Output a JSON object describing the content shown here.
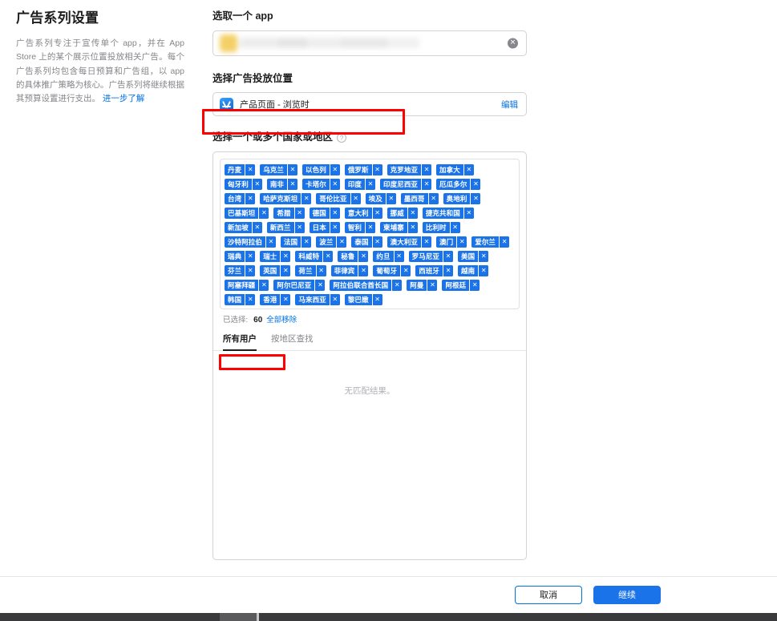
{
  "left": {
    "title": "广告系列设置",
    "description_before_link": "广告系列专注于宣传单个 app，并在 App Store 上的某个展示位置投放相关广告。每个广告系列均包含每日预算和广告组，以 app 的具体推广策略为核心。广告系列将继续根据其预算设置进行支出。",
    "learn_more": "进一步了解"
  },
  "form": {
    "app_label": "选取一个 app",
    "app_value": "",
    "clear_icon": "✕",
    "placement_label": "选择广告投放位置",
    "placement_value": "产品页面 - 浏览时",
    "placement_edit": "编辑",
    "countries_label": "选择一个或多个国家或地区",
    "help_icon": "?"
  },
  "countries": {
    "tag_remove_icon": "✕",
    "selected_label": "已选择:",
    "selected_count": "60",
    "remove_all": "全部移除",
    "empty_result": "无匹配结果。",
    "tabs": [
      {
        "label": "所有用户",
        "active": true
      },
      {
        "label": "按地区查找",
        "active": false
      }
    ],
    "items": [
      "丹麦",
      "乌克兰",
      "以色列",
      "俄罗斯",
      "克罗地亚",
      "加拿大",
      "匈牙利",
      "南非",
      "卡塔尔",
      "印度",
      "印度尼西亚",
      "厄瓜多尔",
      "台湾",
      "哈萨克斯坦",
      "哥伦比亚",
      "埃及",
      "墨西哥",
      "奥地利",
      "巴基斯坦",
      "希腊",
      "德国",
      "意大利",
      "挪威",
      "捷克共和国",
      "新加坡",
      "新西兰",
      "日本",
      "智利",
      "柬埔寨",
      "比利时",
      "沙特阿拉伯",
      "法国",
      "波兰",
      "泰国",
      "澳大利亚",
      "澳门",
      "爱尔兰",
      "瑞典",
      "瑞士",
      "科威特",
      "秘鲁",
      "约旦",
      "罗马尼亚",
      "美国",
      "芬兰",
      "英国",
      "荷兰",
      "菲律宾",
      "葡萄牙",
      "西班牙",
      "越南",
      "阿塞拜疆",
      "阿尔巴尼亚",
      "阿拉伯联合酋长国",
      "阿曼",
      "阿根廷",
      "韩国",
      "香港",
      "马来西亚",
      "黎巴嫩"
    ]
  },
  "footer": {
    "cancel": "取消",
    "continue": "继续"
  },
  "colors": {
    "accent_blue": "#1a73e8",
    "link_blue": "#0071e3",
    "annotation_red": "#ff0000",
    "text_primary": "#1d1d1f",
    "text_secondary": "#86868b"
  }
}
